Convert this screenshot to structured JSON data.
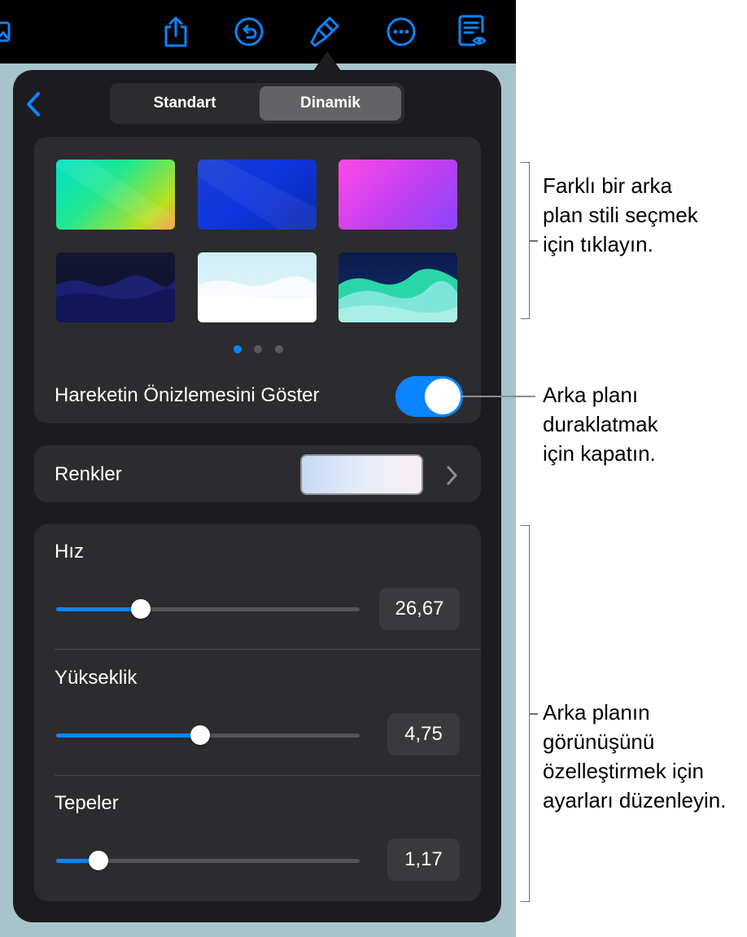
{
  "toolbar": {
    "icons": [
      "image-icon",
      "share-icon",
      "undo-icon",
      "paintbrush-icon",
      "more-icon",
      "presenter-notes-icon"
    ]
  },
  "segmented": {
    "standard_label": "Standart",
    "dynamic_label": "Dinamik",
    "selected": "Dinamik"
  },
  "styles": {
    "pages": 3,
    "current_page": 1,
    "thumbnails": [
      "gradient-green",
      "gradient-blue",
      "gradient-magenta",
      "landscape-night",
      "landscape-white",
      "landscape-teal"
    ]
  },
  "motion_preview": {
    "label": "Hareketin Önizlemesini Göster",
    "on": true
  },
  "colors": {
    "label": "Renkler",
    "swatch_colors": [
      "#c6daf6",
      "#f9eef3"
    ]
  },
  "sliders": [
    {
      "label": "Hız",
      "value_text": "26,67",
      "fraction": 0.28
    },
    {
      "label": "Yükseklik",
      "value_text": "4,75",
      "fraction": 0.475
    },
    {
      "label": "Tepeler",
      "value_text": "1,17",
      "fraction": 0.14
    }
  ],
  "annotations": {
    "styles_note": [
      "Farklı bir arka",
      "plan stili seçmek",
      "için tıklayın."
    ],
    "toggle_note": [
      "Arka planı",
      "duraklatmak",
      "için kapatın."
    ],
    "sliders_note": [
      "Arka planın",
      "görünüşünü",
      "özelleştirmek için",
      "ayarları düzenleyin."
    ]
  },
  "colors_theme": {
    "accent": "#0a84ff",
    "popover_bg": "#1c1c1e",
    "card_bg": "#2c2c2e",
    "app_bg": "#a7c4cc"
  }
}
